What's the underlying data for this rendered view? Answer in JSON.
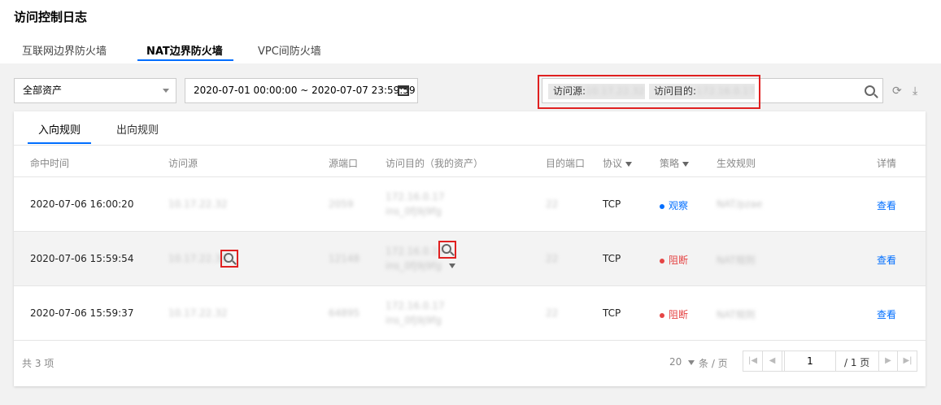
{
  "page_title": "访问控制日志",
  "main_tabs": [
    "互联网边界防火墙",
    "NAT边界防火墙",
    "VPC间防火墙"
  ],
  "asset_select": {
    "value": "全部资产"
  },
  "date_range": {
    "value": "2020-07-01 00:00:00 ~ 2020-07-07 23:59:59"
  },
  "search": {
    "chips": [
      {
        "label": "访问源:",
        "value": "10.17.22.32"
      },
      {
        "label": "访问目的:",
        "value": "172.16.0.17"
      }
    ]
  },
  "sub_tabs": [
    "入向规则",
    "出向规则"
  ],
  "columns": {
    "time": "命中时间",
    "source": "访问源",
    "source_port": "源端口",
    "dest": "访问目的（我的资产）",
    "dest_port": "目的端口",
    "protocol": "协议",
    "strategy": "策略",
    "rule": "生效规则",
    "detail": "详情"
  },
  "rows": [
    {
      "time": "2020-07-06 16:00:20",
      "source": "10.17.22.32",
      "source_port": "2059",
      "dest_ip": "172.16.0.17",
      "dest_name": "ins_0fj9j9fg",
      "dest_port": "22",
      "protocol": "TCP",
      "strategy": "观察",
      "rule": "NAT/pzae",
      "detail": "查看"
    },
    {
      "time": "2020-07-06 15:59:54",
      "source": "10.17.22.32",
      "source_port": "12148",
      "dest_ip": "172.16.0.17",
      "dest_name": "ins_0fj9j9fg",
      "dest_port": "22",
      "protocol": "TCP",
      "strategy": "阻断",
      "rule": "NAT规则",
      "detail": "查看"
    },
    {
      "time": "2020-07-06 15:59:37",
      "source": "10.17.22.32",
      "source_port": "64895",
      "dest_ip": "172.16.0.17",
      "dest_name": "ins_0fj9j9fg",
      "dest_port": "22",
      "protocol": "TCP",
      "strategy": "阻断",
      "rule": "NAT规则",
      "detail": "查看"
    }
  ],
  "footer": {
    "total": "共 3 项",
    "page_size": "20",
    "page_size_unit": "条 / 页",
    "current_page": "1",
    "page_total": "/ 1 页"
  },
  "colors": {
    "accent": "#006eff",
    "observe": "#006eff",
    "block": "#e54545",
    "highlight": "#e02020"
  }
}
